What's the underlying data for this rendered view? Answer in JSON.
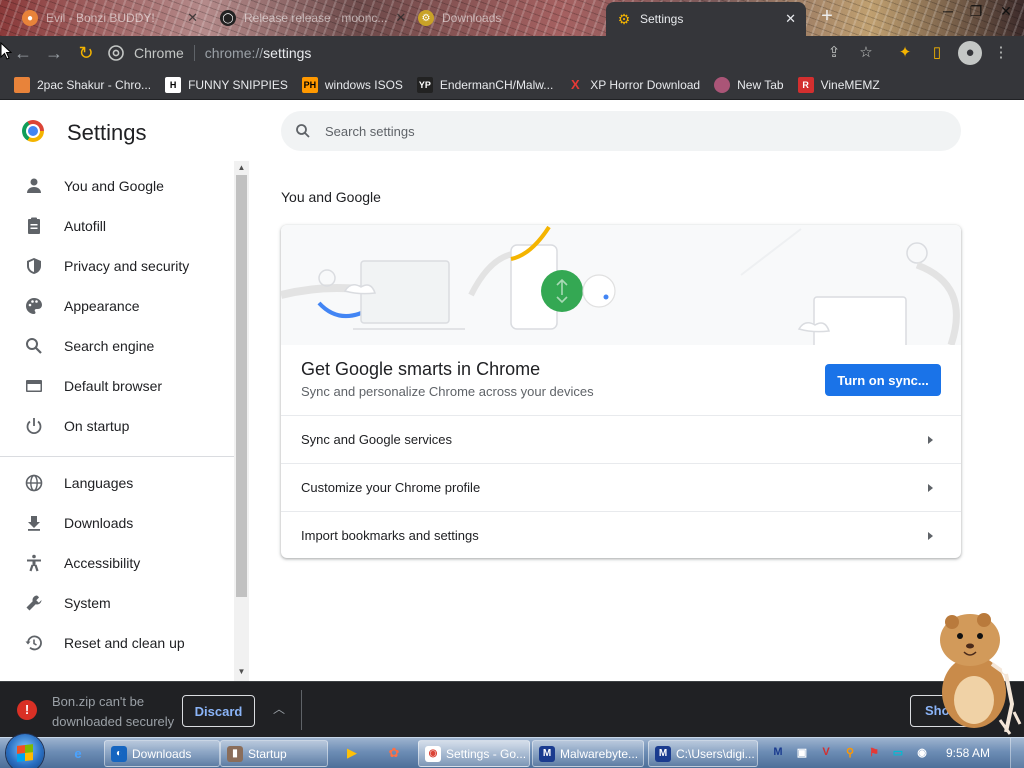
{
  "browser": {
    "tabs": [
      {
        "label": "Evil - Bonzi BUDDY!",
        "favicon": "bonzi-icon"
      },
      {
        "label": "Release release · moonc...",
        "favicon": "github-icon"
      },
      {
        "label": "Downloads",
        "favicon": "downloads-icon"
      },
      {
        "label": "Settings",
        "favicon": "settings-gear-icon"
      }
    ],
    "new_tab": "+",
    "window_controls": {
      "minimize": "─",
      "maximize": "❐",
      "close": "✕"
    }
  },
  "toolbar": {
    "site_label": "Chrome",
    "url_scheme": "chrome://",
    "url_path": "settings"
  },
  "bookmarks": [
    {
      "label": "2pac Shakur - Chro...",
      "icon_text": "",
      "icon_color": "#e8833a"
    },
    {
      "label": "FUNNY SNIPPIES",
      "icon_text": "H",
      "icon_color": "#ffffff"
    },
    {
      "label": "windows ISOS",
      "icon_text": "PH",
      "icon_color": "#ff9900"
    },
    {
      "label": "EndermanCH/Malw...",
      "icon_text": "YP",
      "icon_color": "#222222"
    },
    {
      "label": "XP Horror Download",
      "icon_text": "X",
      "icon_color": "#e53935"
    },
    {
      "label": "New Tab",
      "icon_text": "",
      "icon_color": "#aa5577"
    },
    {
      "label": "VineMEMZ",
      "icon_text": "R",
      "icon_color": "#d32f2f"
    }
  ],
  "settings": {
    "title": "Settings",
    "search_placeholder": "Search settings",
    "sidebar": [
      {
        "label": "You and Google",
        "icon": "person-icon"
      },
      {
        "label": "Autofill",
        "icon": "clipboard-icon"
      },
      {
        "label": "Privacy and security",
        "icon": "shield-icon"
      },
      {
        "label": "Appearance",
        "icon": "palette-icon"
      },
      {
        "label": "Search engine",
        "icon": "search-icon"
      },
      {
        "label": "Default browser",
        "icon": "browser-window-icon"
      },
      {
        "label": "On startup",
        "icon": "power-icon"
      },
      {
        "label": "Languages",
        "icon": "globe-icon"
      },
      {
        "label": "Downloads",
        "icon": "download-icon"
      },
      {
        "label": "Accessibility",
        "icon": "accessibility-icon"
      },
      {
        "label": "System",
        "icon": "wrench-icon"
      },
      {
        "label": "Reset and clean up",
        "icon": "reset-history-icon"
      }
    ],
    "section_title": "You and Google",
    "card": {
      "heading": "Get Google smarts in Chrome",
      "subheading": "Sync and personalize Chrome across your devices",
      "sync_button": "Turn on sync...",
      "rows": [
        {
          "label": "Sync and Google services"
        },
        {
          "label": "Customize your Chrome profile"
        },
        {
          "label": "Import bookmarks and settings"
        }
      ]
    }
  },
  "download_shelf": {
    "message": "Bon.zip can't be downloaded securely",
    "discard_label": "Discard",
    "show_all_label": "Show all"
  },
  "taskbar": {
    "buttons": [
      {
        "label": "Downloads",
        "icon_color": "#1565c0",
        "icon_text": "◐"
      },
      {
        "label": "Startup",
        "icon_color": "#8a6d5a",
        "icon_text": "▮"
      },
      {
        "label": "Settings - Go...",
        "icon_color": "#ffffff",
        "icon_text": "◉"
      },
      {
        "label": "Malwarebyte...",
        "icon_color": "#1a3b8f",
        "icon_text": "M"
      },
      {
        "label": "C:\\Users\\digi...",
        "icon_color": "#1a3b8f",
        "icon_text": "M"
      }
    ],
    "clock": "9:58 AM"
  },
  "colors": {
    "accent": "#1a73e8",
    "chrome_dark": "#35363a",
    "shelf_bg": "#202124",
    "error_red": "#d93025"
  }
}
